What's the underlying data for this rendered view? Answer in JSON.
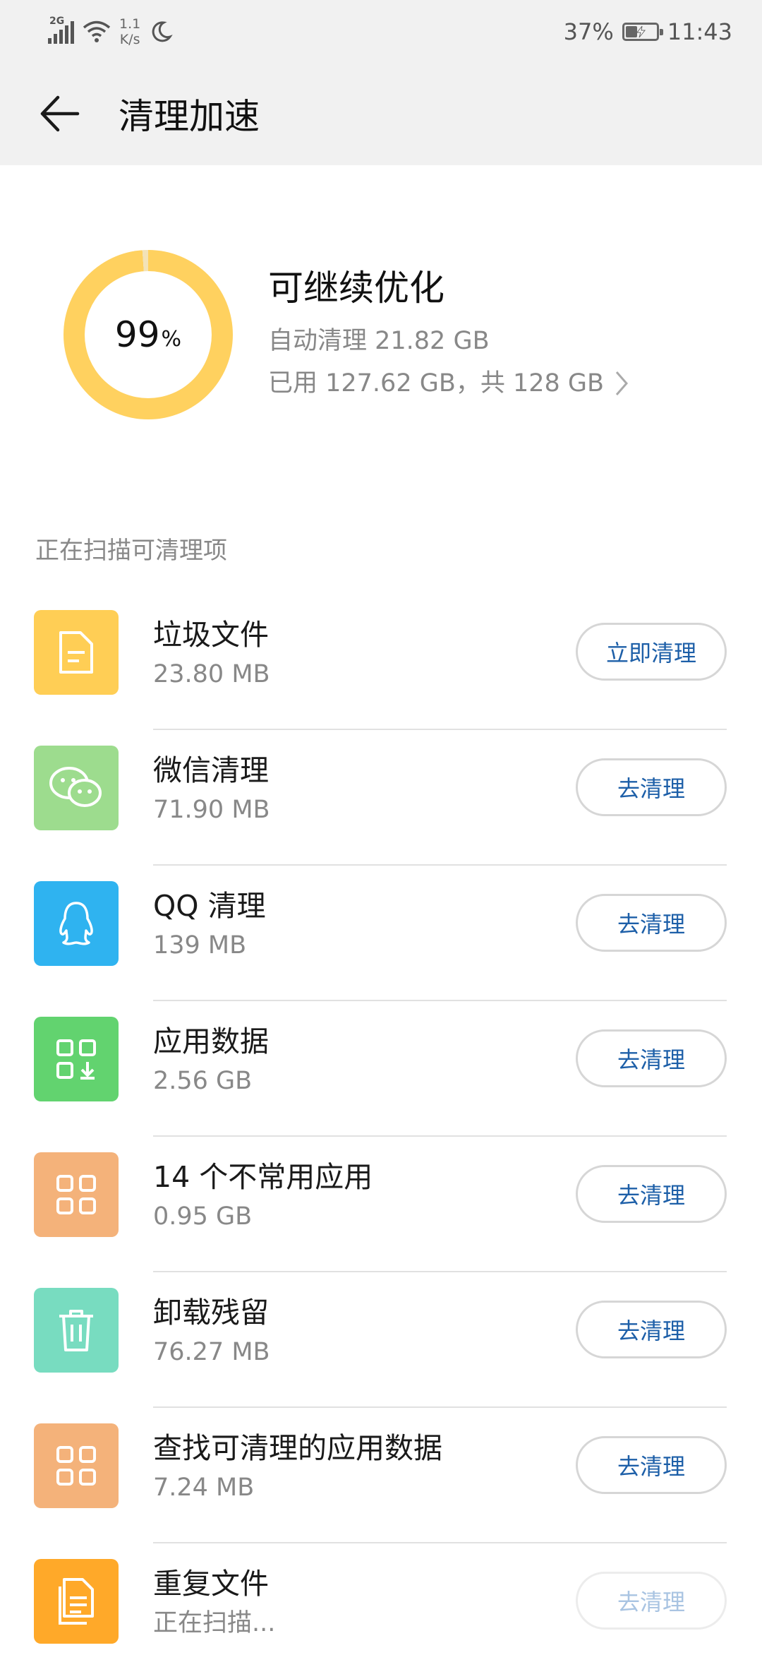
{
  "status_bar": {
    "network": "2G",
    "net_speed_value": "1.1",
    "net_speed_unit": "K/s",
    "battery": "37%",
    "time": "11:43",
    "battery_level": 0.37
  },
  "header": {
    "title": "清理加速"
  },
  "summary": {
    "percent": "99",
    "percent_unit": "%",
    "ring_fill": 0.99,
    "title": "可继续优化",
    "auto_clean": "自动清理 21.82 GB",
    "usage": "已用 127.62 GB，共 128 GB"
  },
  "section_title": "正在扫描可清理项",
  "items": [
    {
      "name": "垃圾文件",
      "size": "23.80 MB",
      "button": "立即清理",
      "icon": "document-icon",
      "color": "#ffce55"
    },
    {
      "name": "微信清理",
      "size": "71.90 MB",
      "button": "去清理",
      "icon": "wechat-icon",
      "color": "#9ddc8e"
    },
    {
      "name": "QQ 清理",
      "size": "139 MB",
      "button": "去清理",
      "icon": "qq-penguin-icon",
      "color": "#2fb3f0"
    },
    {
      "name": "应用数据",
      "size": "2.56 GB",
      "button": "去清理",
      "icon": "app-data-icon",
      "color": "#62d36f"
    },
    {
      "name": "14 个不常用应用",
      "size": "0.95 GB",
      "button": "去清理",
      "icon": "apps-grid-icon",
      "color": "#f4b27a"
    },
    {
      "name": "卸载残留",
      "size": "76.27 MB",
      "button": "去清理",
      "icon": "trash-icon",
      "color": "#78dcc0"
    },
    {
      "name": "查找可清理的应用数据",
      "size": "7.24 MB",
      "button": "去清理",
      "icon": "apps-grid-icon",
      "color": "#f4b27a"
    },
    {
      "name": "重复文件",
      "size": "正在扫描...",
      "button": "去清理",
      "icon": "duplicate-file-icon",
      "color": "#ffa929"
    }
  ]
}
